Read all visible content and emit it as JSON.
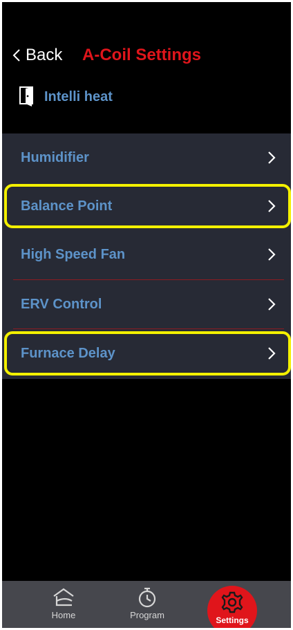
{
  "header": {
    "back_label": "Back",
    "title": "A-Coil Settings",
    "device_name": "Intelli heat",
    "device_icon": "door-icon"
  },
  "settings": {
    "items": [
      {
        "label": "Humidifier",
        "highlighted": false
      },
      {
        "label": "Balance Point",
        "highlighted": true
      },
      {
        "label": "High Speed Fan",
        "highlighted": false
      },
      {
        "label": "ERV Control",
        "highlighted": false
      },
      {
        "label": "Furnace Delay",
        "highlighted": true
      }
    ]
  },
  "nav": {
    "home_label": "Home",
    "program_label": "Program",
    "settings_label": "Settings",
    "active": "Settings"
  },
  "colors": {
    "background": "#000000",
    "accent_red": "#e0151b",
    "item_text": "#5d93c9",
    "list_bg": "#272a35",
    "highlight_yellow": "#f3f000",
    "nav_bg": "#46474d"
  }
}
